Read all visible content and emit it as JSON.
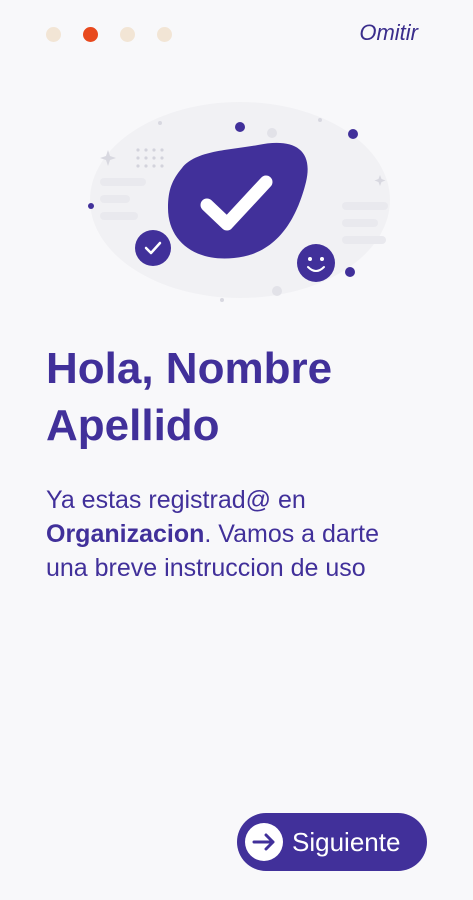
{
  "pagination": {
    "total": 4,
    "current": 2,
    "active_color": "#e8491d",
    "inactive_color": "#f2e5d5"
  },
  "skip_label": "Omitir",
  "greeting": {
    "line1": "Hola, Nombre",
    "line2": "Apellido"
  },
  "description": {
    "part1": "Ya estas registrad@ en ",
    "org_name": "Organizacion",
    "part2": ". Vamos a darte una breve instruccion de uso"
  },
  "next_button": {
    "label": "Siguiente",
    "icon": "arrow-right-circle-icon"
  },
  "illustration": {
    "icons": [
      "check-blob-icon",
      "small-check-badge-icon",
      "smiley-icon"
    ]
  },
  "colors": {
    "primary": "#41309a",
    "background": "#f8f8fa"
  }
}
